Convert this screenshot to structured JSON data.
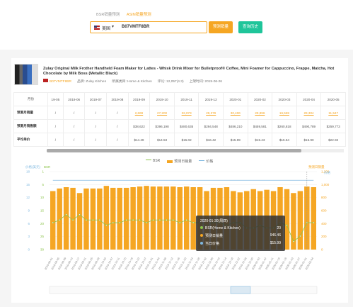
{
  "tabs": [
    "BSR销量预测",
    "ASIN销量预测"
  ],
  "search": {
    "market": "美国",
    "asin": "B07VMTF8BR"
  },
  "buttons": {
    "predict": "预测销量",
    "history": "查询历史"
  },
  "product": {
    "title": "Zulay Original Milk Frother Handheld Foam Maker for Lattes - Whisk Drink Mixer for Bulletproof® Coffee, Mini Foamer for Cappuccino, Frappe, Matcha, Hot Chocolate by Milk Boss (Metallic Black)",
    "asin": "B07VMTF8BR",
    "brand": "品牌: Zulay Kitchen",
    "category": "所属类目: Home & Kitchen",
    "rating": "评论: 12,057(4.3)",
    "date": "上架时间: 2019-06-26"
  },
  "table": {
    "month_label": "月份",
    "months": [
      "19-05",
      "2019-06",
      "2019-07",
      "2019-08",
      "2019-09",
      "2019-10",
      "2019-11",
      "2019-12",
      "2020-01",
      "2020-02",
      "2020-03",
      "2020-04",
      "2020-05"
    ],
    "rows": [
      {
        "label": "预测月销量",
        "values": [
          "/",
          "/",
          "/",
          "/",
          "2,669",
          "27,200",
          "32,073",
          "29,379",
          "30,406",
          "29,896",
          "16,569",
          "29,304",
          "11,547"
        ],
        "orange": true
      },
      {
        "label": "预测月销售额",
        "values": [
          "/",
          "/",
          "/",
          "/",
          "$38,622",
          "$396,198",
          "$480,635",
          "$294,548",
          "$486,210",
          "$459,581",
          "$260,818",
          "$490,789",
          "$259,773"
        ],
        "orange": false
      },
      {
        "label": "平均单价",
        "values": [
          "/",
          "/",
          "/",
          "/",
          "$14.49",
          "$14.53",
          "$15.02",
          "$16.42",
          "$15.99",
          "$15.43",
          "$15.54",
          "$16.90",
          "$22.92"
        ],
        "orange": false
      }
    ]
  },
  "legend": {
    "bsr": "BSR",
    "sales": "预测日销量",
    "price": "价格"
  },
  "axes": {
    "left1": "价格(美元)",
    "left2": "BSR",
    "right1": "预测日销量",
    "right2": "价格"
  },
  "tooltip": {
    "date": "2020-01-30(周四)",
    "bsr_label": "BSR(Home & Kitchen)",
    "bsr_value": "20",
    "sales_label": "预测日销量",
    "sales_value": "946.46",
    "price_label": "当日价格",
    "price_value": "$15.99"
  },
  "colors": {
    "accent": "#f5a623",
    "green": "#1fc59a",
    "bsr_line": "#8bc34a",
    "price_line": "#7fb8e0"
  },
  "chart_data": {
    "type": "bar",
    "categories": [
      "2019-09-01",
      "2019-09-05",
      "2019-09-09",
      "2019-09-13",
      "2019-09-17",
      "2019-09-21",
      "2019-09-25",
      "2019-09-29",
      "2019-10-03",
      "2019-10-07",
      "2019-10-11",
      "2019-10-15",
      "2019-10-19",
      "2019-10-23",
      "2019-10-27",
      "2019-10-31",
      "2019-11-04",
      "2019-11-08",
      "2019-11-12",
      "2019-11-16",
      "2019-11-20",
      "2019-11-24",
      "2019-11-28",
      "2019-12-02",
      "2019-12-06",
      "2019-12-10",
      "2019-12-14",
      "2019-12-18",
      "2019-12-22",
      "2019-12-26",
      "2019-12-30",
      "2020-01-03",
      "2020-01-07",
      "2020-01-11",
      "2020-01-15",
      "2020-01-19",
      "2020-01-23",
      "2020-01-27",
      "2020-01-31",
      "2020-02-04"
    ],
    "series": [
      {
        "name": "预测日销量",
        "values": [
          900,
          940,
          960,
          950,
          870,
          940,
          940,
          940,
          980,
          950,
          950,
          950,
          960,
          970,
          980,
          970,
          970,
          970,
          970,
          960,
          970,
          960,
          960,
          900,
          950,
          950,
          960,
          900,
          880,
          900,
          930,
          900,
          920,
          900,
          960,
          930,
          870,
          900,
          970,
          960
        ]
      },
      {
        "name": "BSR",
        "values": [
          20,
          19,
          17,
          19,
          17,
          19,
          19,
          19,
          21,
          20,
          20,
          19,
          19,
          19,
          20,
          19,
          19,
          19,
          19,
          20,
          19,
          20,
          20,
          21,
          20,
          20,
          21,
          20,
          20,
          22,
          22,
          21,
          22,
          22,
          20,
          21,
          27,
          25,
          20,
          20
        ]
      },
      {
        "name": "价格",
        "values": [
          15.99,
          15.99,
          15.99,
          15.99,
          15.99,
          15.99,
          15.99,
          15.99,
          15.99,
          15.99,
          15.99,
          15.99,
          15.99,
          15.99,
          15.99,
          15.99,
          15.99,
          15.99,
          15.99,
          15.99,
          15.99,
          15.99,
          15.99,
          15.99,
          15.99,
          15.99,
          15.99,
          15.99,
          15.99,
          15.99,
          15.99,
          15.99,
          15.99,
          15.99,
          15.99,
          15.99,
          15.99,
          15.99,
          15.99,
          15.99
        ]
      }
    ],
    "ylim_sales": [
      0,
      1200
    ],
    "ylim_bsr": [
      30,
      1
    ],
    "ylim_price": [
      0,
      18
    ]
  }
}
